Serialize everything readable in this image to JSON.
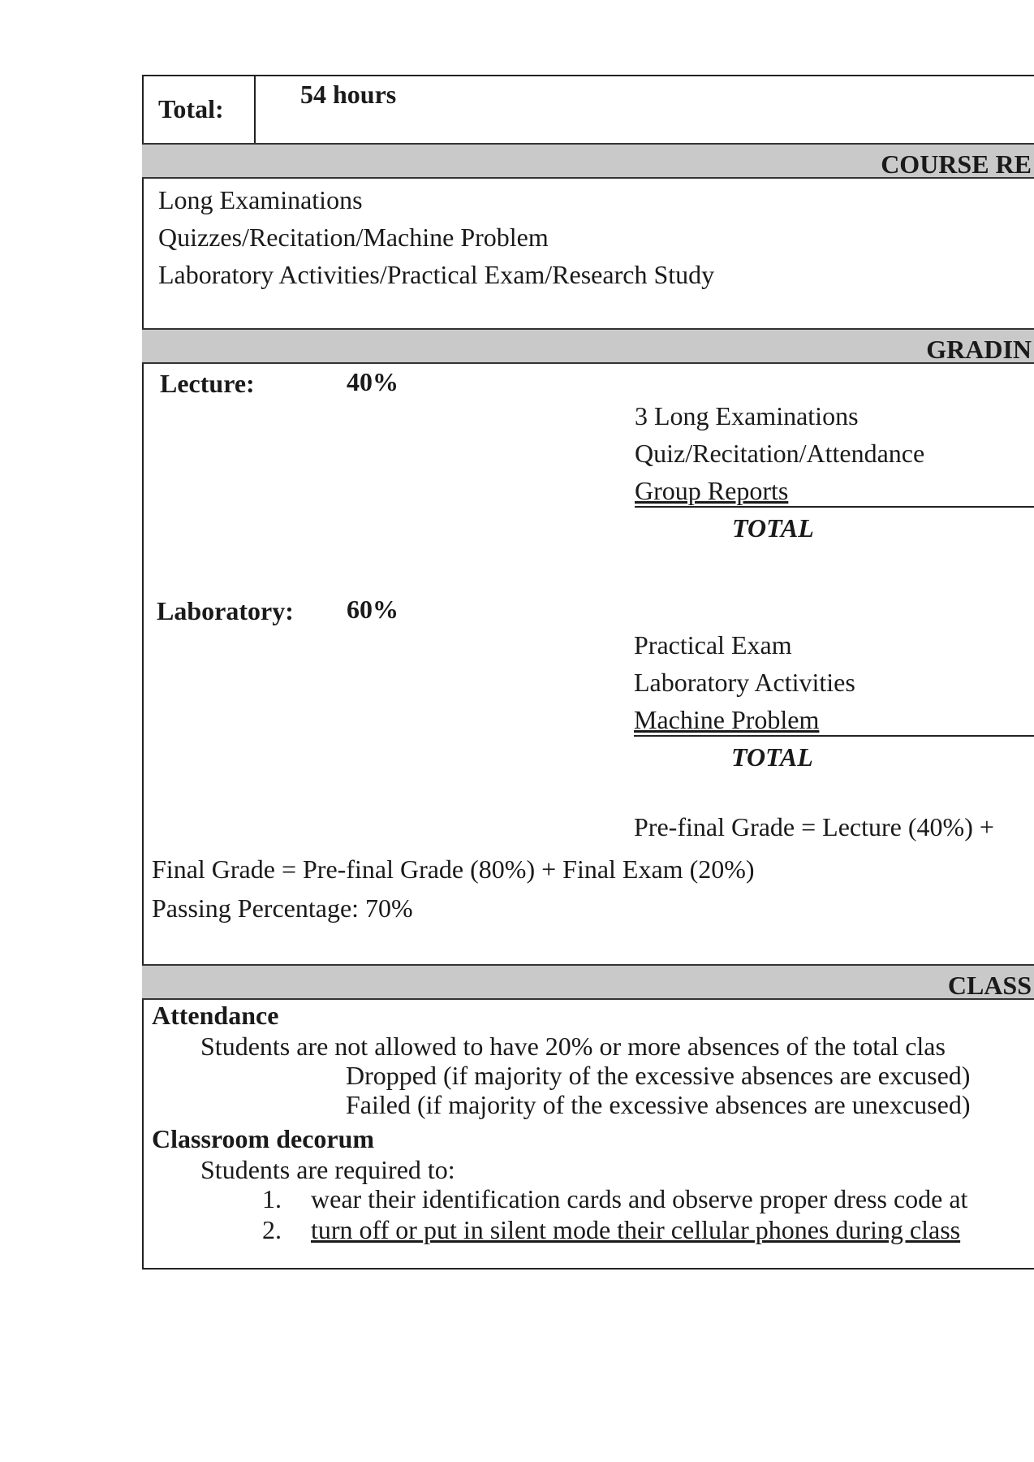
{
  "total": {
    "label": "Total:",
    "value": "54 hours"
  },
  "course_requirements": {
    "header": "COURSE RE",
    "items": [
      "Long Examinations",
      "Quizzes/Recitation/Machine Problem",
      "Laboratory Activities/Practical Exam/Research Study"
    ]
  },
  "grading": {
    "header": "GRADIN",
    "lecture": {
      "label": "Lecture:",
      "percent": "40%",
      "items": [
        "3 Long Examinations",
        "Quiz/Recitation/Attendance",
        "Group Reports"
      ],
      "total": "TOTAL"
    },
    "laboratory": {
      "label": "Laboratory:",
      "percent": "60%",
      "items": [
        "Practical Exam",
        "Laboratory Activities",
        "Machine Problem"
      ],
      "total": "TOTAL"
    },
    "prefinal_formula": "Pre-final Grade = Lecture (40%) +",
    "final_formula": "Final Grade = Pre-final Grade (80%) + Final Exam (20%)",
    "passing": "Passing Percentage:   70%"
  },
  "class_policies": {
    "header": "CLASS",
    "attendance": {
      "heading": "Attendance",
      "text": "Students are not allowed to have 20% or more absences of the total clas",
      "dropped": "Dropped (if majority of the excessive absences are excused)",
      "failed": "Failed (if majority of the excessive absences are unexcused)"
    },
    "decorum": {
      "heading": "Classroom decorum",
      "intro": "Students are required to:",
      "rules": [
        {
          "num": "1.",
          "text": "wear their identification cards and observe proper dress code at"
        },
        {
          "num": "2.",
          "text": "turn off or put in silent mode their cellular phones during class"
        }
      ]
    }
  }
}
